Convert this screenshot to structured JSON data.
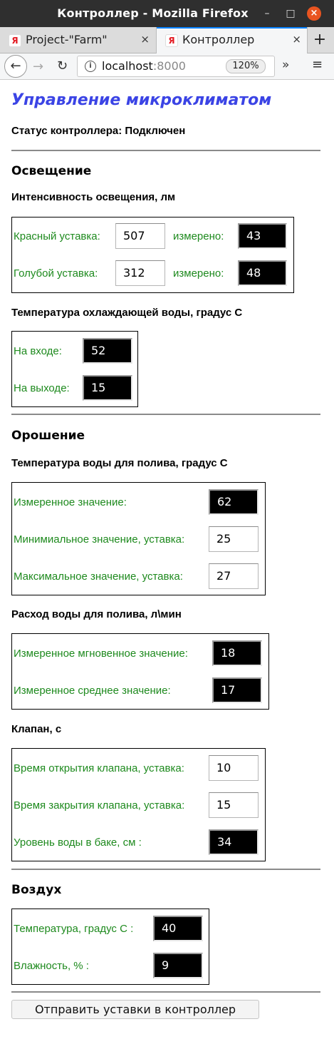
{
  "window": {
    "title": "Контроллер - Mozilla Firefox",
    "minimize": "–",
    "maximize": "□",
    "close": "×"
  },
  "tabs": [
    {
      "label": "Project-\"Farm\"",
      "favicon": "Я",
      "close": "×"
    },
    {
      "label": "Контроллер",
      "favicon": "Я",
      "close": "×",
      "active": true
    }
  ],
  "new_tab": "+",
  "nav": {
    "back": "←",
    "forward": "→",
    "reload": "↻",
    "url_host": "localhost",
    "url_port": ":8000",
    "zoom": "120%",
    "overflow": "»",
    "menu": "≡"
  },
  "page": {
    "title": "Управление микроклиматом",
    "status": "Статус контроллера: Подключен",
    "lighting": {
      "heading": "Освещение",
      "intensity_heading": "Интенсивность освещения, лм",
      "red_label": "Красный уставка:",
      "red_set": "507",
      "red_measured_label": "измерено:",
      "red_measured": "43",
      "blue_label": "Голубой уставка:",
      "blue_set": "312",
      "blue_measured_label": "измерено:",
      "blue_measured": "48",
      "cooling_heading": "Температура охлаждающей воды, градус С",
      "inlet_label": "На входе:",
      "inlet": "52",
      "outlet_label": "На выходе:",
      "outlet": "15"
    },
    "irrigation": {
      "heading": "Орошение",
      "water_temp_heading": "Температура воды для полива, градус С",
      "measured_label": "Измеренное значение:",
      "measured": "62",
      "min_label": "Минимиальное значение, уставка:",
      "min_set": "25",
      "max_label": "Максимальное значение, уставка:",
      "max_set": "27",
      "flow_heading": "Расход воды для полива, л\\мин",
      "instant_label": "Измеренное мгновенное значение:",
      "instant": "18",
      "avg_label": "Измеренное среднее значение:",
      "avg": "17",
      "valve_heading": "Клапан, с",
      "open_label": "Время открытия клапана, уставка:",
      "open_set": "10",
      "close_label": "Время закрытия клапана, уставка:",
      "close_set": "15",
      "level_label": "Уровень воды в баке, см :",
      "level": "34"
    },
    "air": {
      "heading": "Воздух",
      "temp_label": "Температура, градус С :",
      "temp": "40",
      "humidity_label": "Влажность, % :",
      "humidity": "9"
    },
    "send_button": "Отправить уставки в контроллер"
  },
  "colors": {
    "title": "#3b44e5",
    "label": "#1e8a1e",
    "titlebar": "#2f2f2f",
    "close_button": "#e95420",
    "active_tab_accent": "#0a84ff"
  }
}
